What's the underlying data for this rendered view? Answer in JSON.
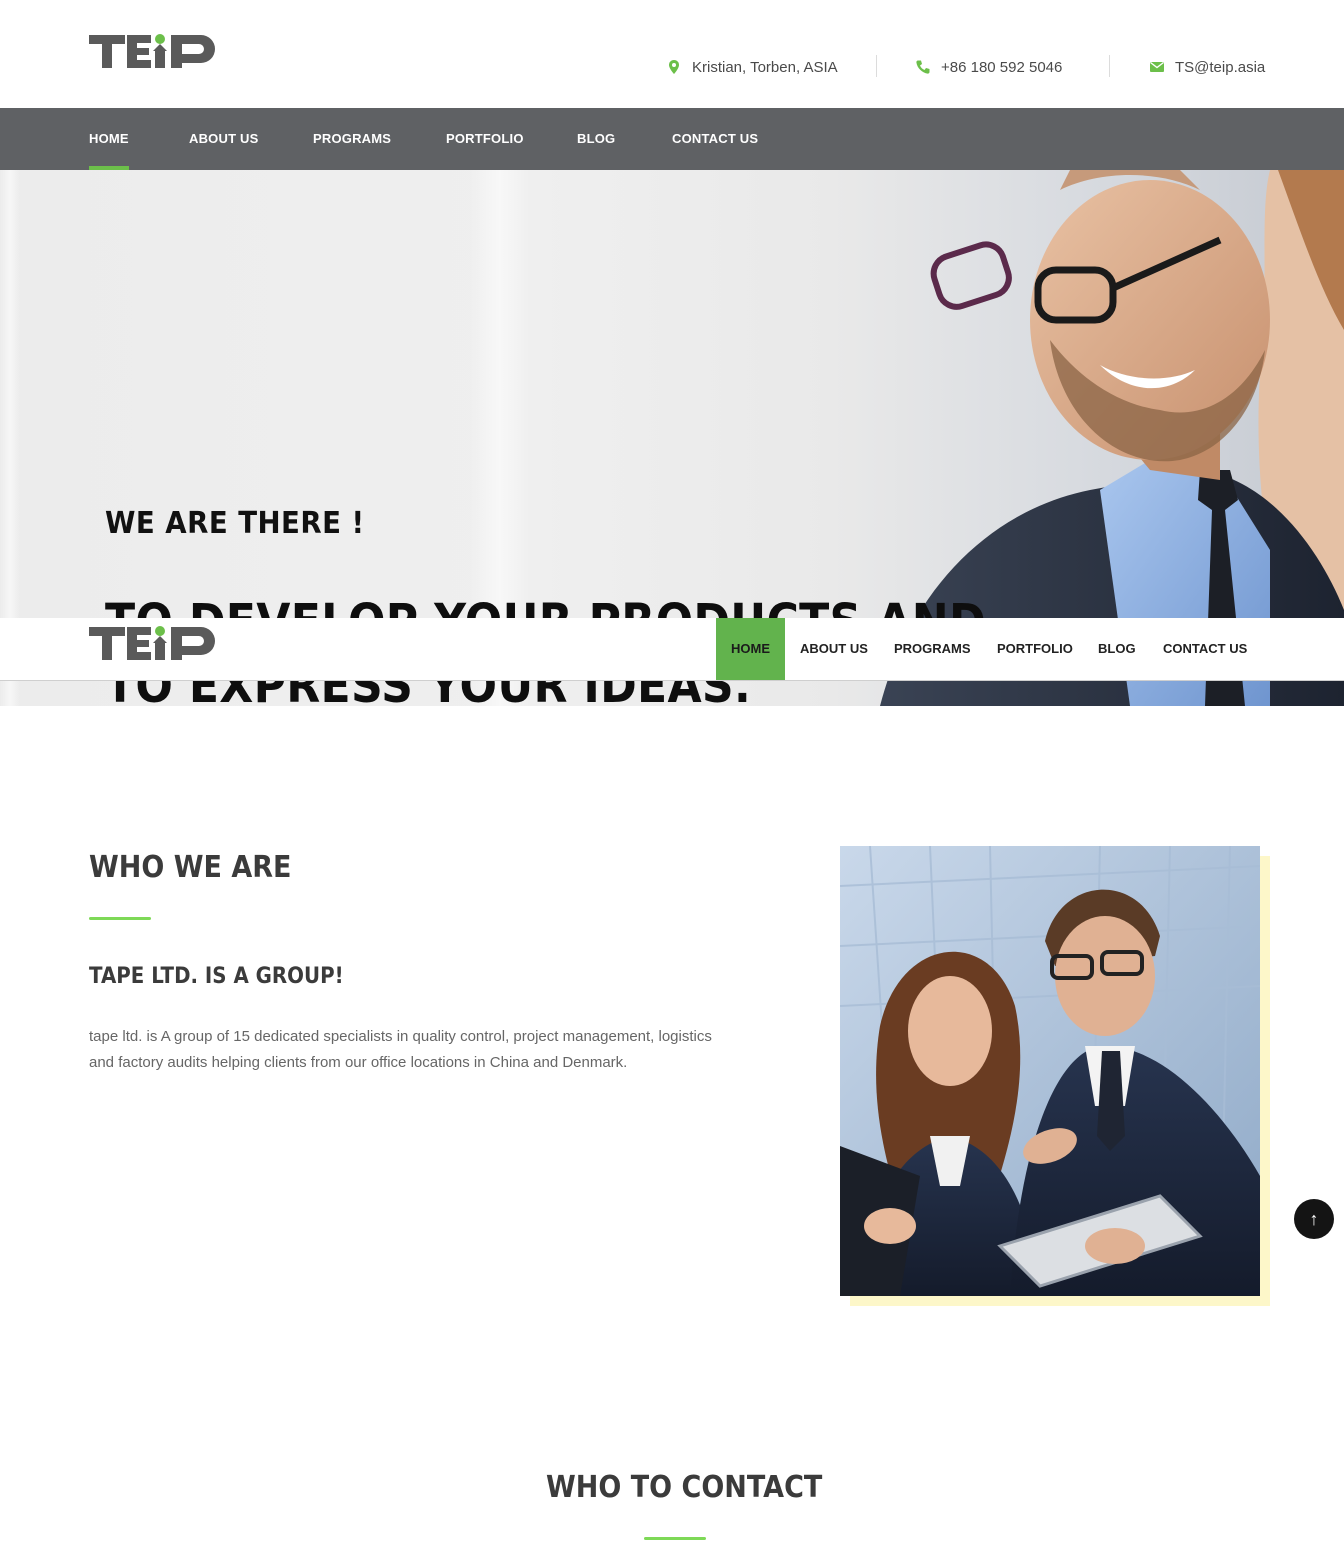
{
  "brand": {
    "logo_text": "TEiP",
    "accent_color": "#6cbf4a",
    "logo_color": "#5a5a5a"
  },
  "topbar": {
    "location": {
      "icon": "map-marker-icon",
      "text": "Kristian, Torben, ASIA"
    },
    "phone": {
      "icon": "phone-icon",
      "text": "+86 180 592 5046"
    },
    "email": {
      "icon": "envelope-icon",
      "text": "TS@teip.asia"
    }
  },
  "nav": {
    "items": [
      {
        "label": "HOME",
        "active": true
      },
      {
        "label": "ABOUT US",
        "active": false
      },
      {
        "label": "PROGRAMS",
        "active": false
      },
      {
        "label": "PORTFOLIO",
        "active": false
      },
      {
        "label": "BLOG",
        "active": false
      },
      {
        "label": "CONTACT US",
        "active": false
      }
    ],
    "bg_color": "#5f6164"
  },
  "hero": {
    "subtitle": "WE ARE THERE !",
    "title": "TO DEVELOP YOUR PRODUCTS AND TO EXPRESS YOUR IDEAS."
  },
  "who_we_are": {
    "heading": "WHO WE ARE",
    "subheading": "TAPE LTD. IS A GROUP!",
    "body": "tape ltd. is A group of 15 dedicated specialists in quality control, project management, logistics and factory audits helping clients from our office locations in China and Denmark."
  },
  "who_to_contact": {
    "heading": "WHO TO CONTACT"
  },
  "scroll_top": {
    "icon": "arrow-up-icon",
    "label": "↑"
  }
}
